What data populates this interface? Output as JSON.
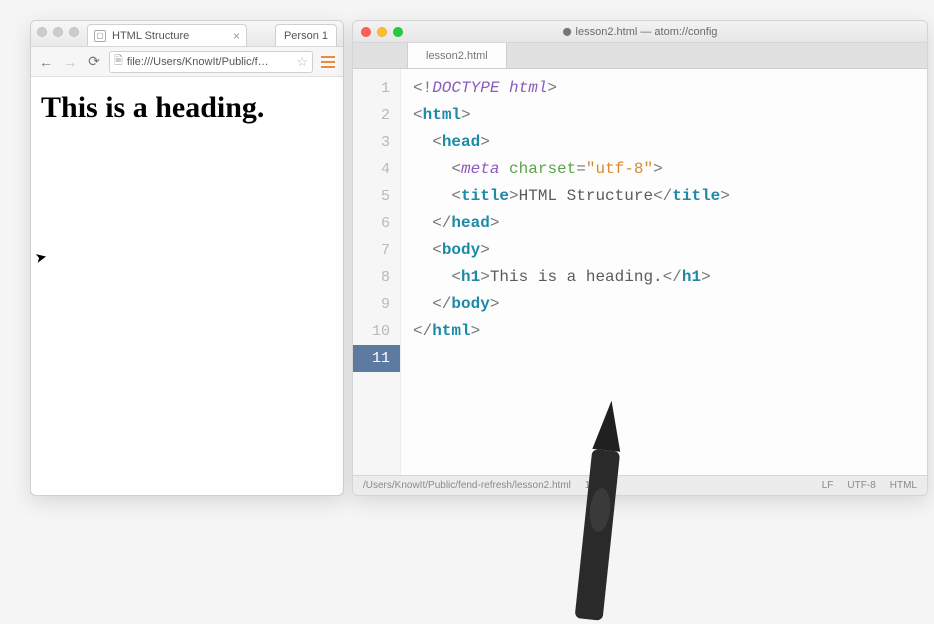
{
  "browser": {
    "tab_title": "HTML Structure",
    "profile_label": "Person 1",
    "url": "file:///Users/KnowIt/Public/f…",
    "heading": "This is a heading."
  },
  "editor": {
    "window_title": "lesson2.html — atom://config",
    "tab_label": "lesson2.html",
    "line_numbers": [
      "1",
      "2",
      "3",
      "4",
      "5",
      "6",
      "7",
      "8",
      "9",
      "10",
      "11"
    ],
    "current_line_index": 10,
    "code": {
      "doctype": "DOCTYPE html",
      "html": "html",
      "head": "head",
      "meta": "meta",
      "attr_charset": "charset",
      "charset_val": "\"utf-8\"",
      "title_tag": "title",
      "title_text": "HTML Structure",
      "body": "body",
      "h1": "h1",
      "h1_text": "This is a heading."
    },
    "status": {
      "path": "/Users/KnowIt/Public/fend-refresh/lesson2.html",
      "pos": "11:",
      "lf": "LF",
      "enc": "UTF-8",
      "lang": "HTML"
    }
  }
}
